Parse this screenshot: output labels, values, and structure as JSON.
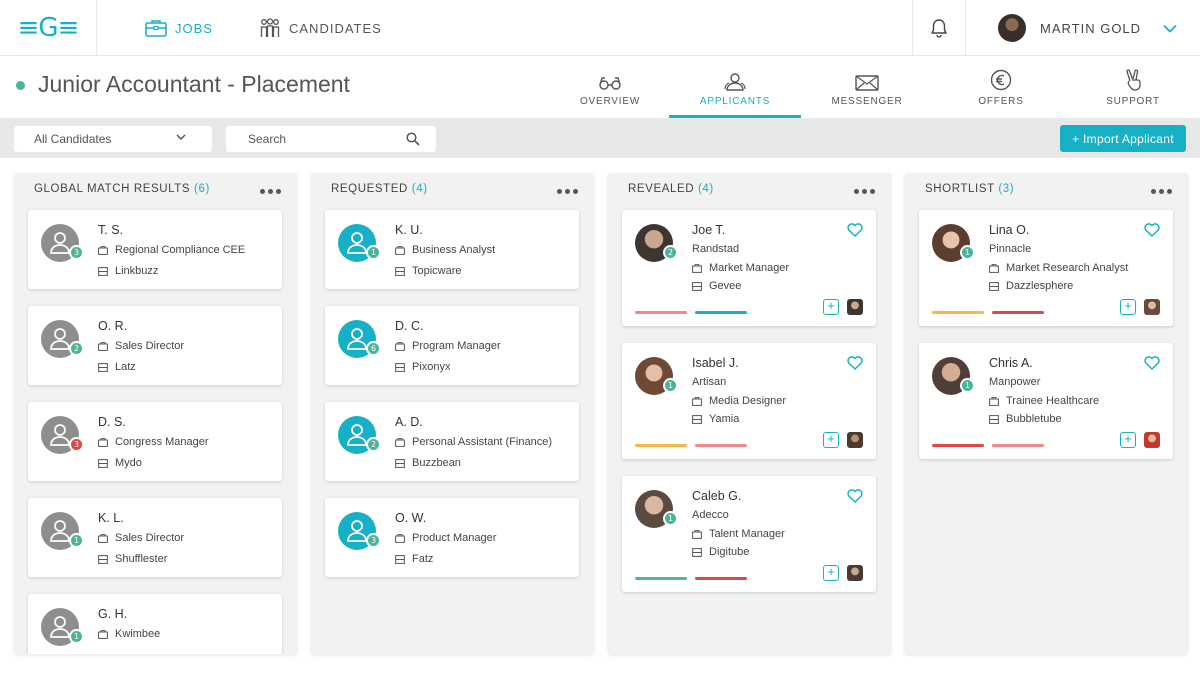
{
  "brand": {
    "logo_text": "≡G≡"
  },
  "topnav": {
    "jobs_label": "JOBS",
    "candidates_label": "CANDIDATES",
    "user_name": "MARTIN GOLD"
  },
  "job": {
    "title": "Junior Accountant - Placement",
    "status_color": "#49b49a",
    "tabs": [
      {
        "label": "OVERVIEW",
        "icon": "glasses-icon",
        "active": false
      },
      {
        "label": "APPLICANTS",
        "icon": "applicants-icon",
        "active": true
      },
      {
        "label": "MESSENGER",
        "icon": "envelope-icon",
        "active": false
      },
      {
        "label": "OFFERS",
        "icon": "euro-icon",
        "active": false
      },
      {
        "label": "SUPPORT",
        "icon": "victory-hand-icon",
        "active": false
      }
    ]
  },
  "filters": {
    "candidate_filter": "All Candidates",
    "search_placeholder": "Search",
    "import_label": "+ Import Applicant"
  },
  "colors": {
    "accent": "#17b0c6",
    "badge_green": "#49b49a",
    "badge_red": "#e04848"
  },
  "columns": [
    {
      "title": "GLOBAL MATCH RESULTS",
      "count": "(6)",
      "cards": [
        {
          "name": "T. S.",
          "job": "Regional Compliance CEE",
          "company": "Linkbuzz",
          "badge": "3"
        },
        {
          "name": "O. R.",
          "job": "Sales Director",
          "company": "Latz",
          "badge": "2"
        },
        {
          "name": "D. S.",
          "job": "Congress Manager",
          "company": "Mydo",
          "badge": "3"
        },
        {
          "name": "K. L.",
          "job": "Sales Director",
          "company": "Shufflester",
          "badge": "1"
        },
        {
          "name": "G. H.",
          "job": "Kwimbee",
          "company": "",
          "badge": "1"
        }
      ]
    },
    {
      "title": "REQUESTED",
      "count": "(4)",
      "cards": [
        {
          "name": "K. U.",
          "job": "Business Analyst",
          "company": "Topicware",
          "badge": "1"
        },
        {
          "name": "D. C.",
          "job": "Program Manager",
          "company": "Pixonyx",
          "badge": "6"
        },
        {
          "name": "A. D.",
          "job": "Personal Assistant (Finance)",
          "company": "Buzzbean",
          "badge": "2"
        },
        {
          "name": "O. W.",
          "job": "Product Manager",
          "company": "Fatz",
          "badge": "3"
        }
      ]
    },
    {
      "title": "REVEALED",
      "count": "(4)",
      "cards": [
        {
          "name": "Joe T.",
          "agency": "Randstad",
          "job": "Market Manager",
          "company": "Gevee",
          "badge": "2"
        },
        {
          "name": "Isabel J.",
          "agency": "Artisan",
          "job": "Media Designer",
          "company": "Yamia",
          "badge": "1"
        },
        {
          "name": "Caleb G.",
          "agency": "Adecco",
          "job": "Talent Manager",
          "company": "Digitube",
          "badge": "1"
        }
      ]
    },
    {
      "title": "SHORTLIST",
      "count": "(3)",
      "cards": [
        {
          "name": "Lina O.",
          "agency": "Pinnacle",
          "job": "Market Research Analyst",
          "company": "Dazzlesphere",
          "badge": "1"
        },
        {
          "name": "Chris A.",
          "agency": "Manpower",
          "job": "Trainee Healthcare",
          "company": "Bubbletube",
          "badge": "1"
        }
      ]
    }
  ]
}
